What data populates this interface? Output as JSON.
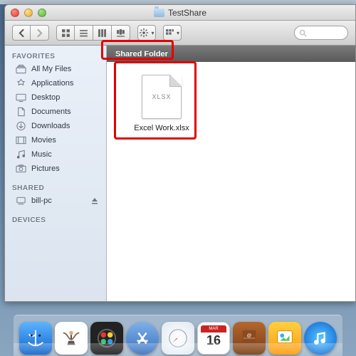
{
  "window": {
    "title": "TestShare"
  },
  "banner": {
    "label": "Shared Folder"
  },
  "sidebar": {
    "favorites_header": "FAVORITES",
    "shared_header": "SHARED",
    "devices_header": "DEVICES",
    "favorites": [
      {
        "label": "All My Files"
      },
      {
        "label": "Applications"
      },
      {
        "label": "Desktop"
      },
      {
        "label": "Documents"
      },
      {
        "label": "Downloads"
      },
      {
        "label": "Movies"
      },
      {
        "label": "Music"
      },
      {
        "label": "Pictures"
      }
    ],
    "shared": [
      {
        "label": "bill-pc"
      }
    ]
  },
  "file": {
    "ext": "XLSX",
    "name": "Excel Work.xlsx"
  },
  "calendar": {
    "month": "MAR",
    "day": "16"
  }
}
